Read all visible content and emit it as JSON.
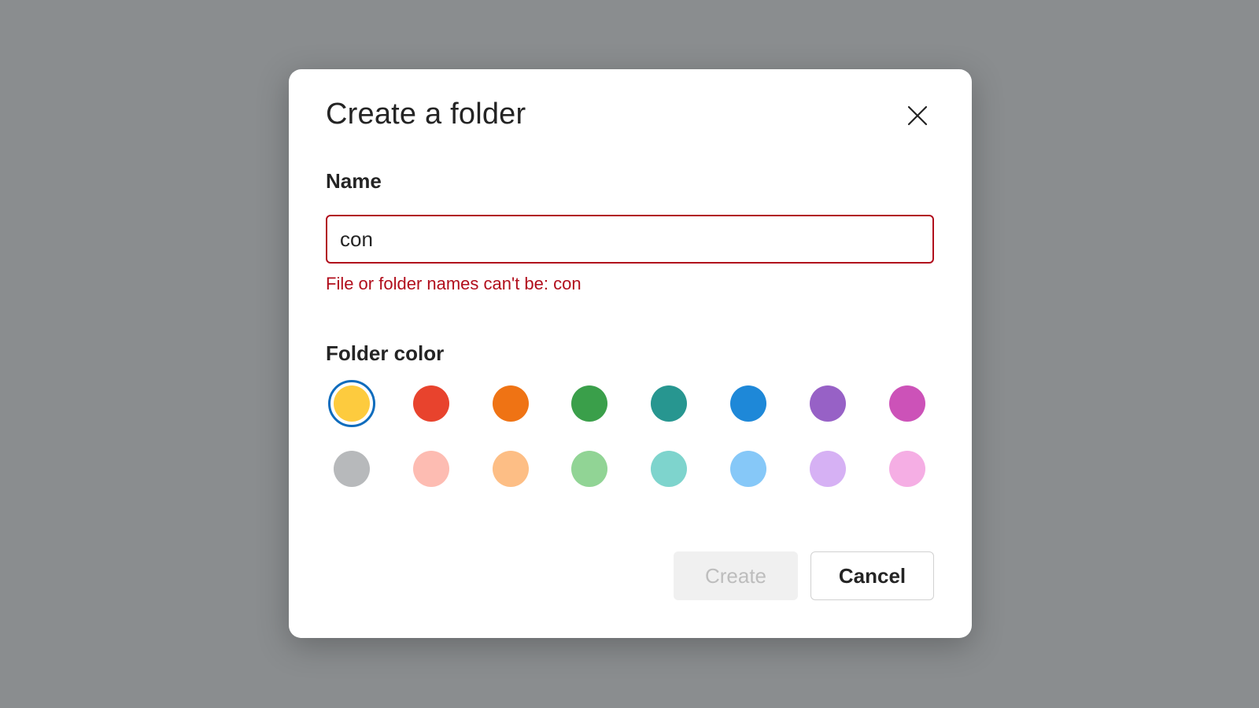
{
  "dialog": {
    "title": "Create a folder",
    "close_icon": "close-icon"
  },
  "name_field": {
    "label": "Name",
    "value": "con",
    "error": "File or folder names can't be: con",
    "error_color": "#b10e1c"
  },
  "folder_color": {
    "label": "Folder color",
    "selected": "yellow",
    "selection_ring_color": "#0f6cbd",
    "rows": [
      [
        {
          "name": "yellow",
          "hex": "#fdcb3e"
        },
        {
          "name": "red",
          "hex": "#e8432d"
        },
        {
          "name": "orange",
          "hex": "#ef7314"
        },
        {
          "name": "green",
          "hex": "#3a9f4a"
        },
        {
          "name": "teal",
          "hex": "#279690"
        },
        {
          "name": "blue",
          "hex": "#1e88d8"
        },
        {
          "name": "purple",
          "hex": "#9761c6"
        },
        {
          "name": "magenta",
          "hex": "#cc52b8"
        }
      ],
      [
        {
          "name": "gray",
          "hex": "#b7b9bb"
        },
        {
          "name": "light-red",
          "hex": "#fdbcb2"
        },
        {
          "name": "light-orange",
          "hex": "#fdbe85"
        },
        {
          "name": "light-green",
          "hex": "#91d495"
        },
        {
          "name": "light-teal",
          "hex": "#7ed4cd"
        },
        {
          "name": "light-blue",
          "hex": "#86c8f8"
        },
        {
          "name": "light-purple",
          "hex": "#d6b1f4"
        },
        {
          "name": "light-magenta",
          "hex": "#f5aee4"
        }
      ]
    ]
  },
  "actions": {
    "create_label": "Create",
    "create_disabled": true,
    "cancel_label": "Cancel"
  }
}
